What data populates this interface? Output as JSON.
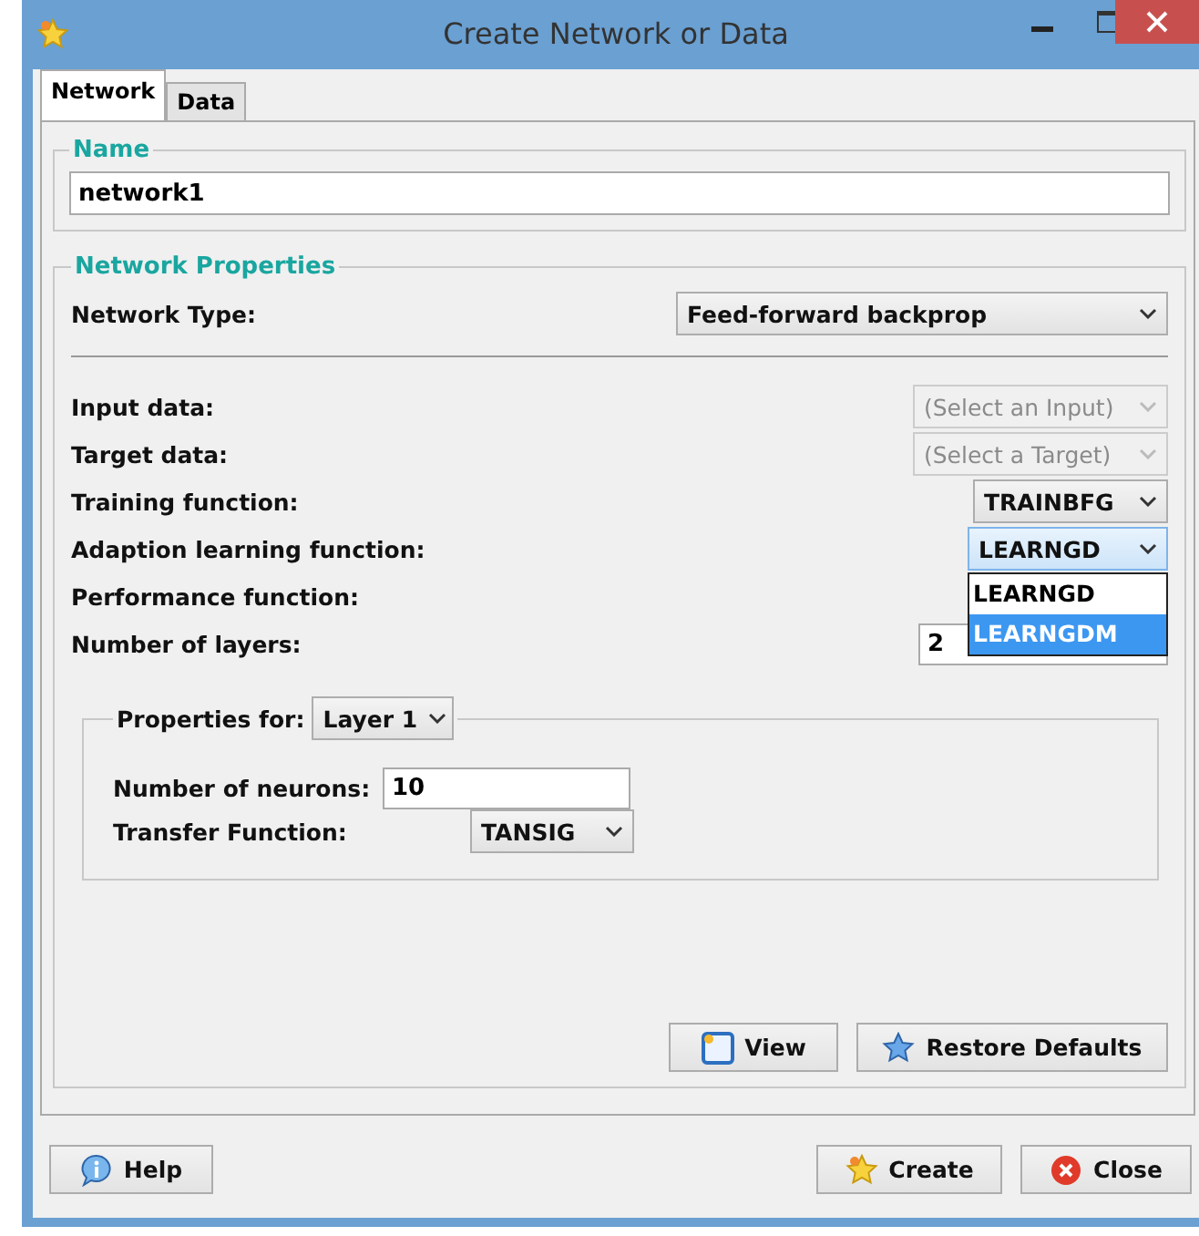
{
  "window": {
    "title": "Create Network or Data"
  },
  "tabs": [
    {
      "label": "Network",
      "selected": true
    },
    {
      "label": "Data",
      "selected": false
    }
  ],
  "name_group": {
    "title": "Name",
    "value": "network1"
  },
  "network_properties": {
    "title": "Network Properties",
    "network_type": {
      "label": "Network Type:",
      "value": "Feed-forward backprop"
    },
    "rows": [
      {
        "label": "Input data:",
        "kind": "combo",
        "value": "(Select an Input)",
        "disabled": true,
        "open": false
      },
      {
        "label": "Target data:",
        "kind": "combo",
        "value": "(Select a Target)",
        "disabled": true,
        "open": false
      },
      {
        "label": "Training function:",
        "kind": "combo",
        "value": "TRAINBFG",
        "disabled": false,
        "open": false
      },
      {
        "label": "Adaption learning function:",
        "kind": "combo",
        "value": "LEARNGD",
        "disabled": false,
        "open": true,
        "options": [
          {
            "label": "LEARNGD",
            "highlighted": false
          },
          {
            "label": "LEARNGDM",
            "highlighted": true
          }
        ]
      },
      {
        "label": "Performance function:",
        "kind": "hidden"
      },
      {
        "label": "Number of layers:",
        "kind": "field",
        "value": "2"
      }
    ],
    "layer_group": {
      "label": "Properties for:",
      "layer": "Layer 1",
      "neurons": {
        "label": "Number of neurons:",
        "value": "10"
      },
      "transfer": {
        "label": "Transfer Function:",
        "value": "TANSIG"
      }
    },
    "buttons": [
      {
        "label": "View",
        "kind": "view"
      },
      {
        "label": "Restore Defaults",
        "kind": "restore"
      }
    ]
  },
  "footer": {
    "left": [
      {
        "label": "Help",
        "kind": "help"
      }
    ],
    "right": [
      {
        "label": "Create",
        "kind": "create"
      },
      {
        "label": "Close",
        "kind": "close"
      }
    ]
  }
}
